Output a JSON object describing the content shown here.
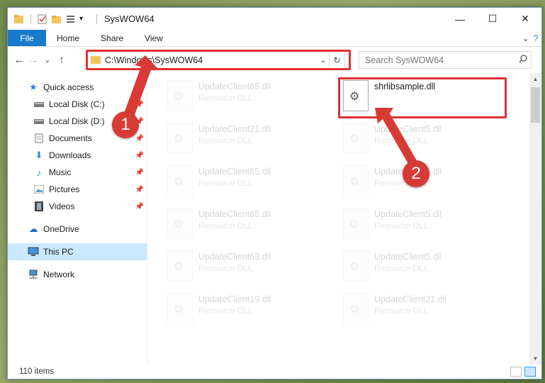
{
  "window": {
    "title": "SysWOW64",
    "controls": {
      "minimize": "—",
      "maximize": "☐",
      "close": "✕"
    }
  },
  "ribbon": {
    "tabs": [
      "File",
      "Home",
      "Share",
      "View"
    ],
    "help": "?"
  },
  "nav": {
    "back": "←",
    "forward": "→",
    "recent": "⌄",
    "up": "↑",
    "address": "C:\\Windows\\SysWOW64",
    "address_dropdown": "⌄",
    "refresh": "↻",
    "search_placeholder": "Search SysWOW64",
    "search_icon": "⌕"
  },
  "sidebar": {
    "items": [
      {
        "label": "Quick access",
        "icon": "star-icon"
      },
      {
        "label": "Local Disk (C:)",
        "icon": "drive-icon",
        "pinned": true
      },
      {
        "label": "Local Disk (D:)",
        "icon": "drive-icon",
        "pinned": true
      },
      {
        "label": "Documents",
        "icon": "documents-icon",
        "pinned": true
      },
      {
        "label": "Downloads",
        "icon": "downloads-icon",
        "pinned": true
      },
      {
        "label": "Music",
        "icon": "music-icon",
        "pinned": true
      },
      {
        "label": "Pictures",
        "icon": "pictures-icon",
        "pinned": true
      },
      {
        "label": "Videos",
        "icon": "videos-icon",
        "pinned": true
      },
      {
        "label": "OneDrive",
        "icon": "cloud-icon"
      },
      {
        "label": "This PC",
        "icon": "computer-icon",
        "selected": true
      },
      {
        "label": "Network",
        "icon": "network-icon"
      }
    ]
  },
  "files": {
    "col1": [
      {
        "name": "UpdateClient65.dll",
        "type": "Resource DLL"
      },
      {
        "name": "UpdateClient21.dll",
        "type": "Resource DLL"
      },
      {
        "name": "UpdateClient65.dll",
        "type": "Resource DLL"
      },
      {
        "name": "UpdateClient65.dll",
        "type": "Resource DLL"
      },
      {
        "name": "UpdateClient63.dll",
        "type": "Resource DLL"
      },
      {
        "name": "UpdateClient19.dll",
        "type": "Resource DLL"
      }
    ],
    "col2": [
      {
        "name": "shrlibsample.dll",
        "type": ""
      },
      {
        "name": "UpdateClient5.dll",
        "type": "Resource DLL"
      },
      {
        "name": "UpdateClient5.dll",
        "type": "Resource DLL"
      },
      {
        "name": "UpdateClient5.dll",
        "type": "Resource DLL"
      },
      {
        "name": "UpdateClient5.dll",
        "type": "Resource DLL"
      },
      {
        "name": "UpdateClient21.dll",
        "type": "Resource DLL"
      }
    ]
  },
  "status": {
    "item_count": "110 items"
  },
  "annotations": {
    "badge1": "1",
    "badge2": "2"
  },
  "colors": {
    "accent": "#1979ca",
    "highlight": "#e03030",
    "badge": "#d83a36",
    "selected": "#cce8ff"
  }
}
